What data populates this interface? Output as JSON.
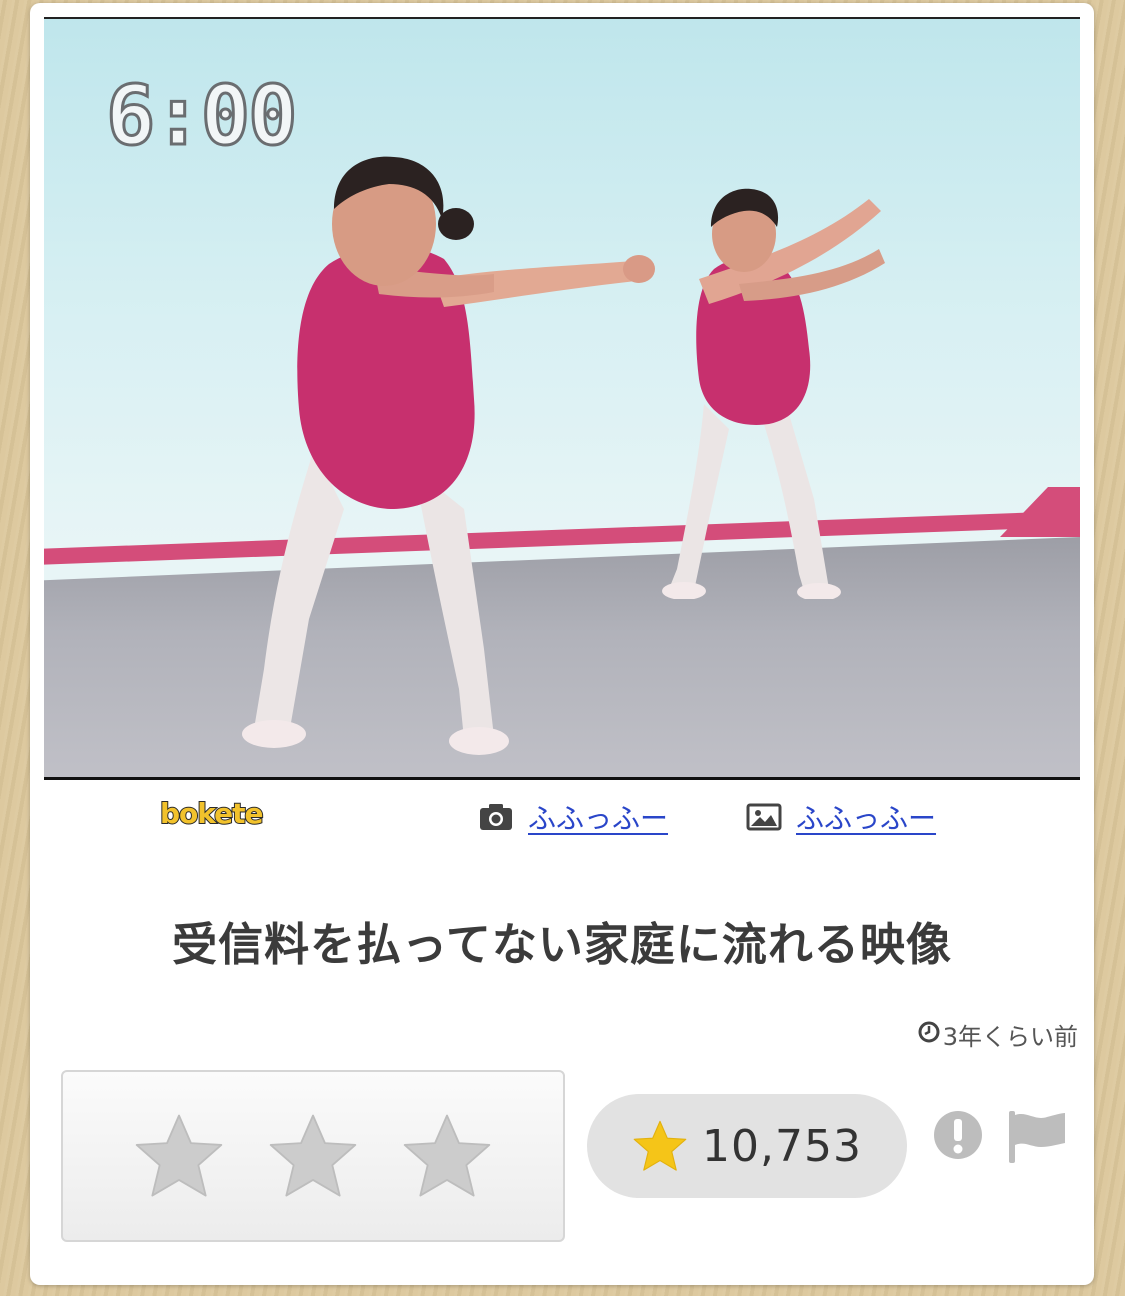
{
  "photo": {
    "timer_text": "6:00"
  },
  "meta": {
    "logo_text": "bokete",
    "photo_credit": {
      "icon": "camera-icon",
      "name": "ふふっふー"
    },
    "image_credit": {
      "icon": "image-icon",
      "name": "ふふっふー"
    }
  },
  "post": {
    "title": "受信料を払ってない家庭に流れる映像",
    "posted_time": "3年くらい前"
  },
  "rating": {
    "empty_stars": 3,
    "star_color": "#cccccc",
    "score_star_color": "#f5c518",
    "score": "10,753"
  },
  "actions": {
    "report_icon": "exclamation-circle-icon",
    "flag_icon": "flag-icon"
  },
  "colors": {
    "background": "#dcc79b",
    "card": "#ffffff",
    "link": "#2a46c9",
    "title": "#3b3b3b"
  }
}
